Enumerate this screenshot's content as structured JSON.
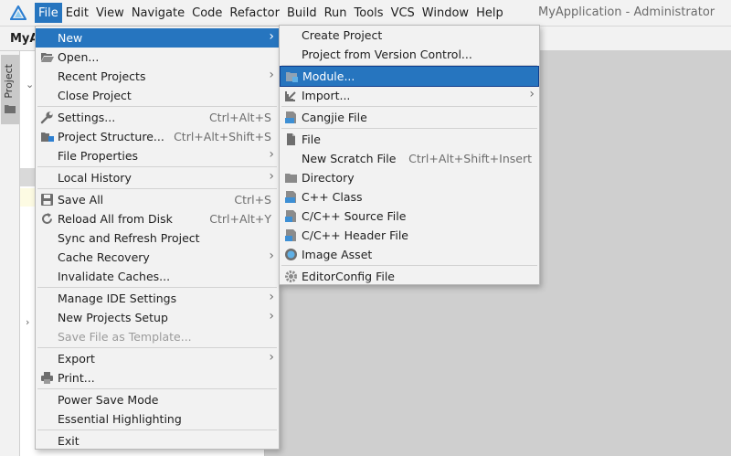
{
  "window": {
    "title": "MyApplication - Administrator",
    "project_name": "MyA",
    "side_tab": "Project"
  },
  "menubar": {
    "items": [
      "File",
      "Edit",
      "View",
      "Navigate",
      "Code",
      "Refactor",
      "Build",
      "Run",
      "Tools",
      "VCS",
      "Window",
      "Help"
    ]
  },
  "file_menu": {
    "items": [
      {
        "label": "New",
        "shortcut": "",
        "submenu": true
      },
      {
        "label": "Open...",
        "shortcut": ""
      },
      {
        "label": "Recent Projects",
        "shortcut": "",
        "submenu": true
      },
      {
        "label": "Close Project",
        "shortcut": ""
      },
      {
        "label": "Settings...",
        "shortcut": "Ctrl+Alt+S"
      },
      {
        "label": "Project Structure...",
        "shortcut": "Ctrl+Alt+Shift+S"
      },
      {
        "label": "File Properties",
        "shortcut": "",
        "submenu": true
      },
      {
        "label": "Local History",
        "shortcut": "",
        "submenu": true
      },
      {
        "label": "Save All",
        "shortcut": "Ctrl+S"
      },
      {
        "label": "Reload All from Disk",
        "shortcut": "Ctrl+Alt+Y"
      },
      {
        "label": "Sync and Refresh Project",
        "shortcut": ""
      },
      {
        "label": "Cache Recovery",
        "shortcut": "",
        "submenu": true
      },
      {
        "label": "Invalidate Caches...",
        "shortcut": ""
      },
      {
        "label": "Manage IDE Settings",
        "shortcut": "",
        "submenu": true
      },
      {
        "label": "New Projects Setup",
        "shortcut": "",
        "submenu": true
      },
      {
        "label": "Save File as Template...",
        "shortcut": "",
        "disabled": true
      },
      {
        "label": "Export",
        "shortcut": "",
        "submenu": true
      },
      {
        "label": "Print...",
        "shortcut": ""
      },
      {
        "label": "Power Save Mode",
        "shortcut": ""
      },
      {
        "label": "Essential Highlighting",
        "shortcut": ""
      },
      {
        "label": "Exit",
        "shortcut": ""
      }
    ]
  },
  "new_menu": {
    "items": [
      {
        "label": "Create Project",
        "shortcut": ""
      },
      {
        "label": "Project from Version Control...",
        "shortcut": ""
      },
      {
        "label": "Module...",
        "shortcut": "",
        "selected": true
      },
      {
        "label": "Import...",
        "shortcut": "",
        "submenu": true
      },
      {
        "label": "Cangjie File",
        "shortcut": ""
      },
      {
        "label": "File",
        "shortcut": ""
      },
      {
        "label": "New Scratch File",
        "shortcut": "Ctrl+Alt+Shift+Insert"
      },
      {
        "label": "Directory",
        "shortcut": ""
      },
      {
        "label": "C++ Class",
        "shortcut": ""
      },
      {
        "label": "C/C++ Source File",
        "shortcut": ""
      },
      {
        "label": "C/C++ Header File",
        "shortcut": ""
      },
      {
        "label": "Image Asset",
        "shortcut": ""
      },
      {
        "label": "EditorConfig File",
        "shortcut": ""
      }
    ]
  },
  "colors": {
    "accent": "#2675bf",
    "menu_bg": "#f2f2f2",
    "editor_bg": "#cfcfcf"
  }
}
